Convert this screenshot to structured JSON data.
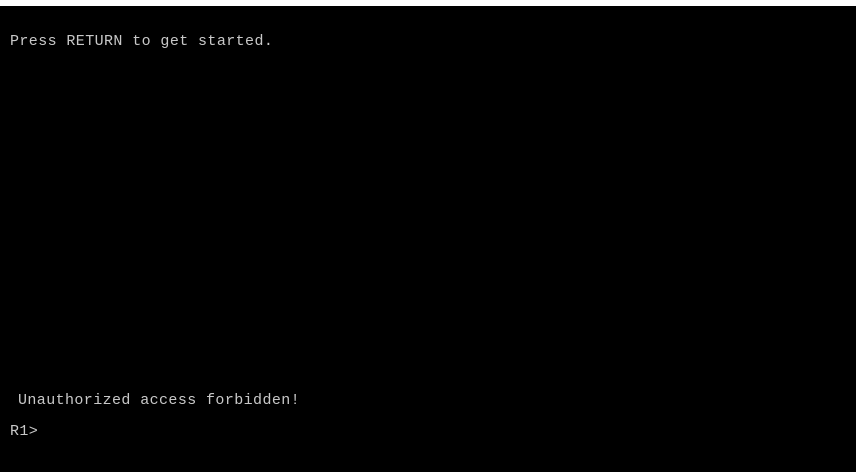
{
  "terminal": {
    "lines": [
      "Press RETURN to get started.",
      "Unauthorized access forbidden!"
    ],
    "prompt": "R1>"
  },
  "colors": {
    "background": "#000000",
    "text": "#c8c8c8",
    "border": "#ffffff"
  }
}
